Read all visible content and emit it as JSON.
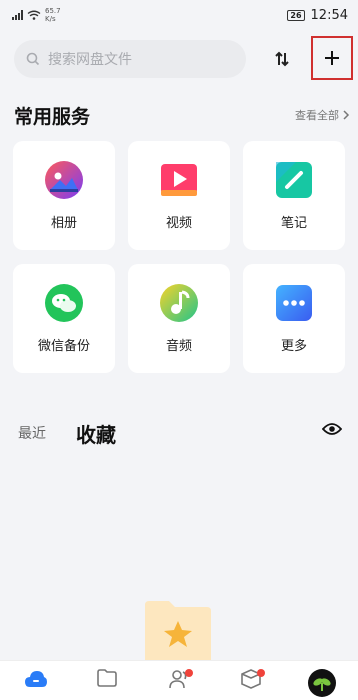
{
  "status_bar": {
    "network_label": "4G",
    "speed_value": "65.7",
    "speed_unit": "K/s",
    "battery": "26",
    "time": "12:54"
  },
  "search": {
    "placeholder": "搜索网盘文件",
    "icon": "search-icon"
  },
  "toolbar": {
    "sort_icon": "sort-icon",
    "add_icon": "plus-icon",
    "highlight_color": "#d0302f"
  },
  "services": {
    "title": "常用服务",
    "see_all": "查看全部",
    "items": [
      {
        "label": "相册",
        "icon": "photo-album-icon"
      },
      {
        "label": "视频",
        "icon": "video-icon"
      },
      {
        "label": "笔记",
        "icon": "note-icon"
      },
      {
        "label": "微信备份",
        "icon": "wechat-backup-icon"
      },
      {
        "label": "音频",
        "icon": "audio-icon"
      },
      {
        "label": "更多",
        "icon": "more-icon"
      }
    ]
  },
  "tabs": {
    "recent": "最近",
    "favorites": "收藏",
    "active": "favorites"
  },
  "bottom_nav": {
    "items": [
      {
        "icon": "cloud-home-icon",
        "active": true
      },
      {
        "icon": "folder-icon",
        "active": false
      },
      {
        "icon": "contacts-icon",
        "active": false,
        "badge": true
      },
      {
        "icon": "box-icon",
        "active": false,
        "badge": true
      },
      {
        "icon": "avatar-icon",
        "active": false
      }
    ]
  }
}
